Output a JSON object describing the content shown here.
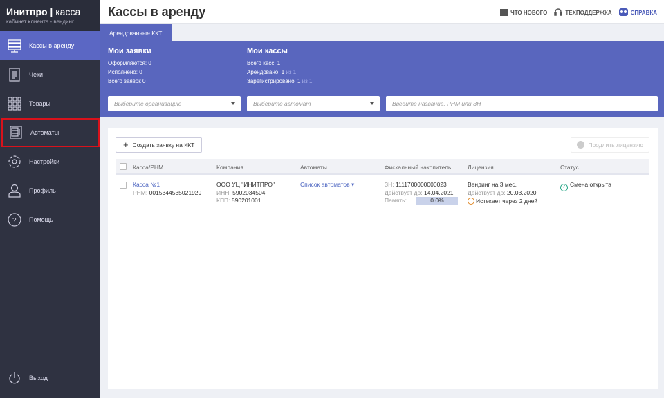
{
  "brand": {
    "name": "Инитпро",
    "product": "касса",
    "subtitle": "кабинет клиента - вендинг"
  },
  "nav": [
    {
      "label": "Кассы в аренду",
      "icon": "server-icon"
    },
    {
      "label": "Чеки",
      "icon": "receipt-icon"
    },
    {
      "label": "Товары",
      "icon": "grid-icon"
    },
    {
      "label": "Автоматы",
      "icon": "vending-machine-icon"
    },
    {
      "label": "Настройки",
      "icon": "gear-icon"
    },
    {
      "label": "Профиль",
      "icon": "user-icon"
    },
    {
      "label": "Помощь",
      "icon": "help-icon"
    }
  ],
  "logout": "Выход",
  "header": {
    "title": "Кассы в аренду",
    "whats_new": "ЧТО НОВОГО",
    "support": "ТЕХПОДДЕРЖКА",
    "help": "СПРАВКА"
  },
  "tab": "Арендованные ККТ",
  "requests": {
    "title": "Мои заявки",
    "processing": "Оформляются: 0",
    "done": "Исполнено: 0",
    "total": "Всего заявок 0"
  },
  "registers": {
    "title": "Мои кассы",
    "total": "Всего касс: 1",
    "rented": "Арендовано: 1",
    "rented_of": "из 1",
    "registered": "Зарегистрировано: 1",
    "registered_of": "из 1"
  },
  "filters": {
    "org_placeholder": "Выберите организацию",
    "machine_placeholder": "Выберите автомат",
    "search_placeholder": "Введите название, РНМ или ЗН"
  },
  "actions": {
    "create": "Создать заявку на ККТ",
    "extend": "Продлить лицензию"
  },
  "table": {
    "headers": [
      "Касса/РНМ",
      "Компания",
      "Автоматы",
      "Фискальный накопитель",
      "Лицензия",
      "Статус"
    ],
    "rows": [
      {
        "name": "Касса №1",
        "rnm_label": "РНМ:",
        "rnm": "0015344535021929",
        "company": "ООО УЦ \"ИНИТПРО\"",
        "inn_label": "ИНН:",
        "inn": "5902034504",
        "kpp_label": "КПП:",
        "kpp": "590201001",
        "machines": "Список автоматов",
        "zn_label": "ЗН:",
        "zn": "1111700000000023",
        "fn_valid_label": "Действует до:",
        "fn_valid": "14.04.2021",
        "memory_label": "Память:",
        "memory": "0.0%",
        "license": "Вендинг на 3 мес.",
        "lic_valid_label": "Действует до:",
        "lic_valid": "20.03.2020",
        "expires": "Истекает через 2 дней",
        "status": "Смена открыта"
      }
    ]
  },
  "colors": {
    "accent": "#5966be",
    "sidebar": "#2f3241",
    "highlight": "#d9121b"
  }
}
